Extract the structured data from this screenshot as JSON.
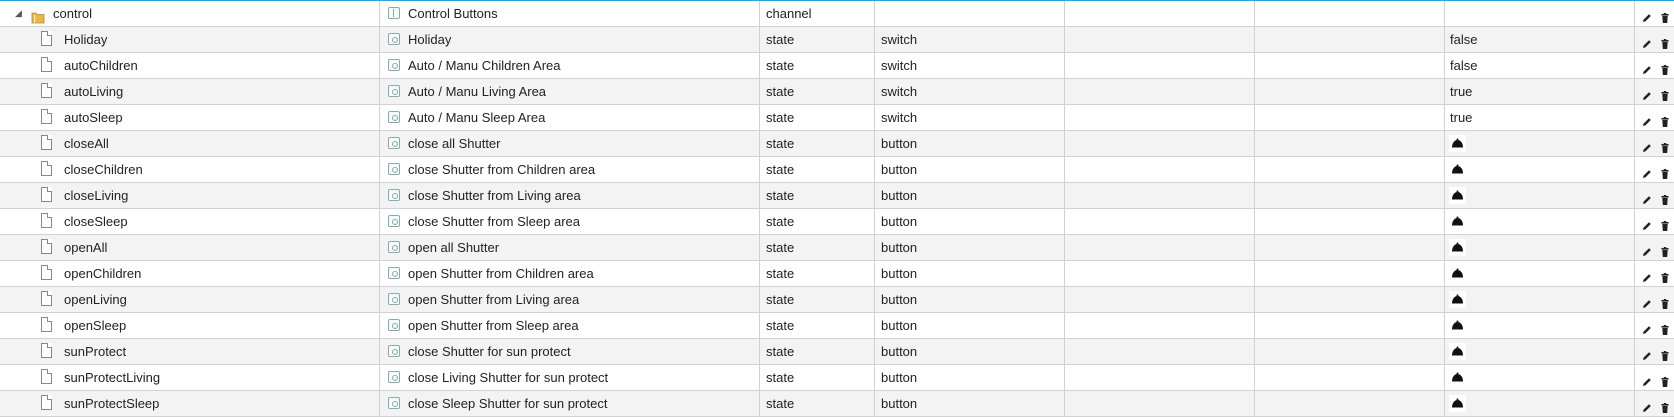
{
  "colors": {
    "accent": "#31a0d8",
    "folder": "#e8b84a",
    "grid_line": "#d2d2d2"
  },
  "rows": [
    {
      "id": "control",
      "name": "Control Buttons",
      "type": "channel",
      "role": "",
      "value": "",
      "kind": "channel",
      "icon": "folder-icon"
    },
    {
      "id": "Holiday",
      "name": "Holiday",
      "type": "state",
      "role": "switch",
      "value": "false",
      "kind": "state",
      "icon": "file-icon"
    },
    {
      "id": "autoChildren",
      "name": "Auto / Manu Children Area",
      "type": "state",
      "role": "switch",
      "value": "false",
      "kind": "state",
      "icon": "file-icon"
    },
    {
      "id": "autoLiving",
      "name": "Auto / Manu Living Area",
      "type": "state",
      "role": "switch",
      "value": "true",
      "kind": "state",
      "icon": "file-icon"
    },
    {
      "id": "autoSleep",
      "name": "Auto / Manu Sleep Area",
      "type": "state",
      "role": "switch",
      "value": "true",
      "kind": "state",
      "icon": "file-icon"
    },
    {
      "id": "closeAll",
      "name": "close all Shutter",
      "type": "state",
      "role": "button",
      "value": "",
      "kind": "state",
      "icon": "file-icon"
    },
    {
      "id": "closeChildren",
      "name": "close Shutter from Children area",
      "type": "state",
      "role": "button",
      "value": "",
      "kind": "state",
      "icon": "file-icon"
    },
    {
      "id": "closeLiving",
      "name": "close Shutter from Living area",
      "type": "state",
      "role": "button",
      "value": "",
      "kind": "state",
      "icon": "file-icon"
    },
    {
      "id": "closeSleep",
      "name": "close Shutter from Sleep area",
      "type": "state",
      "role": "button",
      "value": "",
      "kind": "state",
      "icon": "file-icon"
    },
    {
      "id": "openAll",
      "name": "open all Shutter",
      "type": "state",
      "role": "button",
      "value": "",
      "kind": "state",
      "icon": "file-icon"
    },
    {
      "id": "openChildren",
      "name": "open Shutter from Children area",
      "type": "state",
      "role": "button",
      "value": "",
      "kind": "state",
      "icon": "file-icon"
    },
    {
      "id": "openLiving",
      "name": "open Shutter from Living area",
      "type": "state",
      "role": "button",
      "value": "",
      "kind": "state",
      "icon": "file-icon"
    },
    {
      "id": "openSleep",
      "name": "open Shutter from Sleep area",
      "type": "state",
      "role": "button",
      "value": "",
      "kind": "state",
      "icon": "file-icon"
    },
    {
      "id": "sunProtect",
      "name": "close Shutter for sun protect",
      "type": "state",
      "role": "button",
      "value": "",
      "kind": "state",
      "icon": "file-icon"
    },
    {
      "id": "sunProtectLiving",
      "name": "close Living Shutter for sun protect",
      "type": "state",
      "role": "button",
      "value": "",
      "kind": "state",
      "icon": "file-icon"
    },
    {
      "id": "sunProtectSleep",
      "name": "close Sleep Shutter for sun protect",
      "type": "state",
      "role": "button",
      "value": "",
      "kind": "state",
      "icon": "file-icon"
    }
  ]
}
